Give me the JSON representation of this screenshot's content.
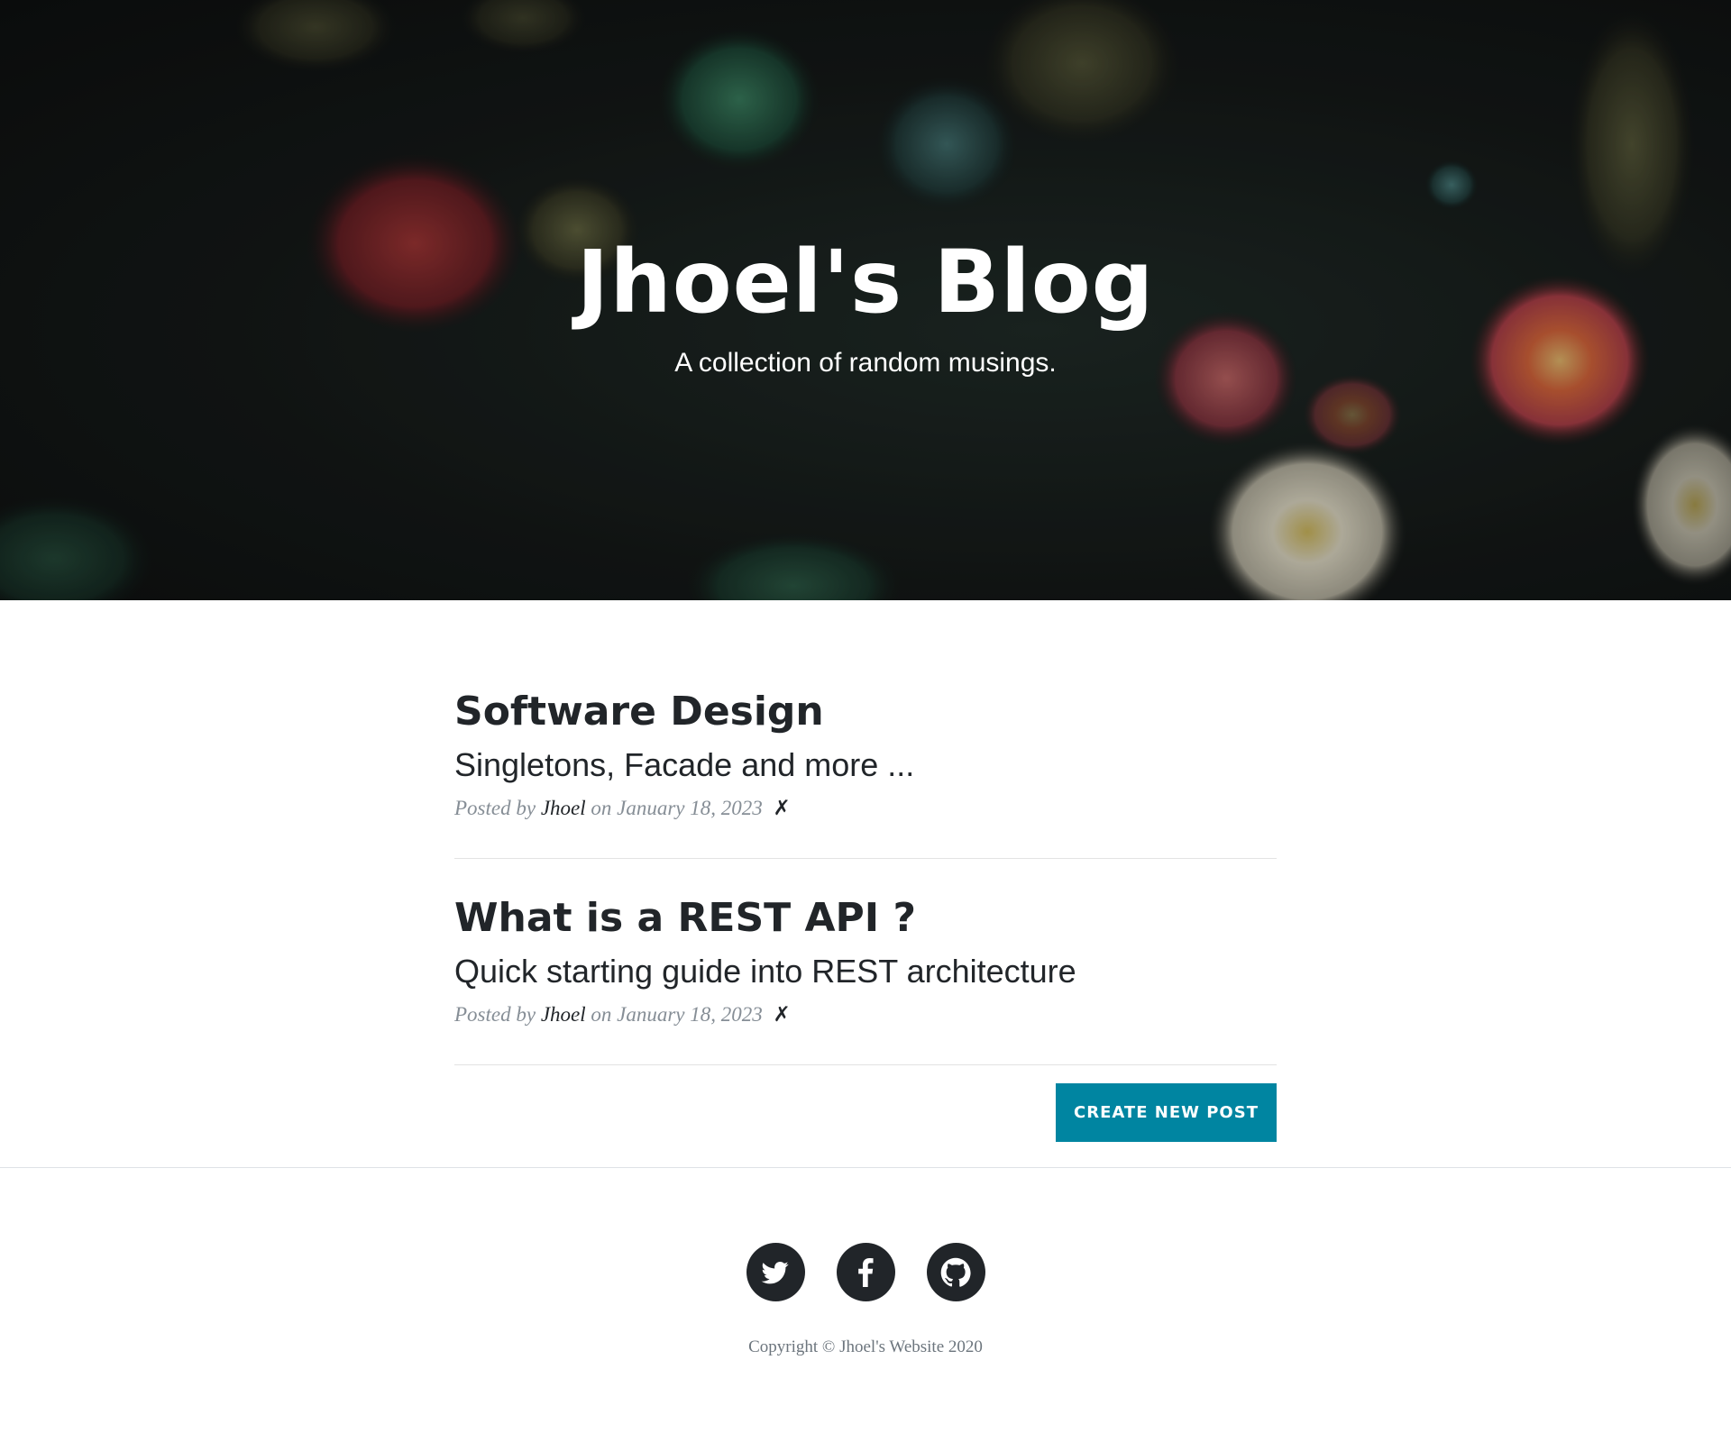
{
  "header": {
    "title": "Jhoel's Blog",
    "subtitle": "A collection of random musings.",
    "background_icon": "sea-anemones-photo"
  },
  "posts": [
    {
      "title": "Software Design",
      "subtitle": "Singletons, Facade and more ...",
      "meta_prefix": "Posted by",
      "author": "Jhoel",
      "date_text": "on January 18, 2023",
      "delete_label": "✗"
    },
    {
      "title": "What is a REST API ?",
      "subtitle": "Quick starting guide into REST architecture",
      "meta_prefix": "Posted by",
      "author": "Jhoel",
      "date_text": "on January 18, 2023",
      "delete_label": "✗"
    }
  ],
  "actions": {
    "create_label": "Create New Post"
  },
  "footer": {
    "social": [
      {
        "icon": "twitter-icon"
      },
      {
        "icon": "facebook-icon"
      },
      {
        "icon": "github-icon"
      }
    ],
    "copyright": "Copyright © Jhoel's Website 2020"
  },
  "colors": {
    "accent": "#0085a1",
    "text": "#212529",
    "meta": "#868e96",
    "copyright": "#6c757d"
  }
}
